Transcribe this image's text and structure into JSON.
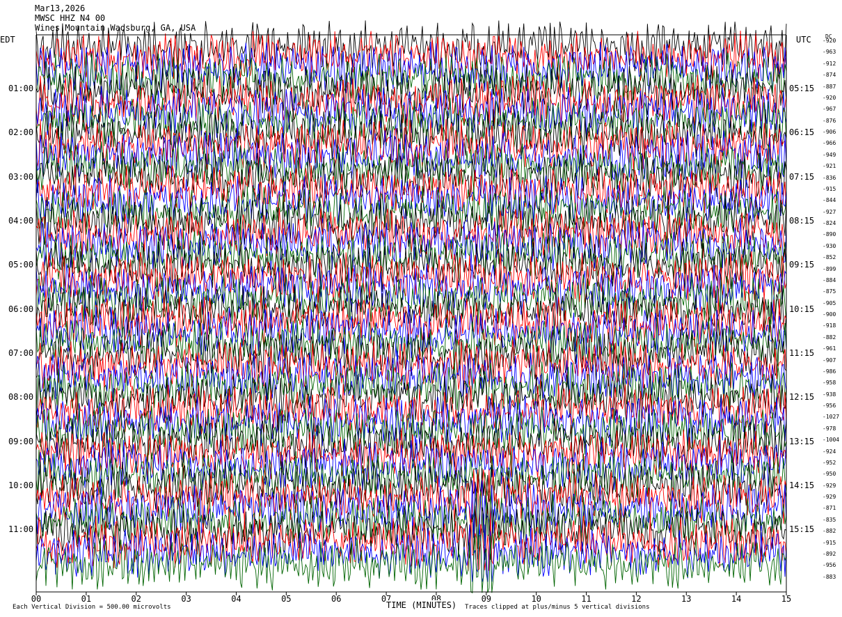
{
  "header": {
    "date": "Mar13,2026",
    "station": "MWSC HHZ N4 00",
    "location": "Wines Mountain Wadsburg, GA, USA"
  },
  "left_axis_label": "EDT",
  "right_axis_label": "UTC",
  "dc_label": "DC",
  "xaxis_title": "TIME (MINUTES)",
  "footer_left": "Each Vertical Division =  500.00 microvolts",
  "footer_right": "Traces clipped at plus/minus 5 vertical divisions",
  "chart_data": {
    "type": "line",
    "title": "",
    "xlabel": "TIME (MINUTES)",
    "ylabel": "",
    "xlim": [
      0,
      15
    ],
    "x_ticks": [
      "00",
      "01",
      "02",
      "03",
      "04",
      "05",
      "06",
      "07",
      "08",
      "09",
      "10",
      "11",
      "12",
      "13",
      "14",
      "15"
    ],
    "left_time_labels": [
      "01:00",
      "02:00",
      "03:00",
      "04:00",
      "05:00",
      "06:00",
      "07:00",
      "08:00",
      "09:00",
      "10:00",
      "11:00"
    ],
    "right_time_labels": [
      "05:15",
      "06:15",
      "07:15",
      "08:15",
      "09:15",
      "10:15",
      "11:15",
      "12:15",
      "13:15",
      "14:15",
      "15:15"
    ],
    "trace_color_cycle": [
      "#000000",
      "#ff0000",
      "#0000ff",
      "#006400"
    ],
    "traces_per_hour": 4,
    "trace_count": 48,
    "dc_offsets": [
      -920,
      -963,
      -912,
      -874,
      -887,
      -920,
      -967,
      -876,
      -906,
      -966,
      -949,
      -921,
      -836,
      -915,
      -844,
      -927,
      -824,
      -890,
      -930,
      -852,
      -899,
      -884,
      -875,
      -905,
      -900,
      -918,
      -882,
      -961,
      -907,
      -986,
      -958,
      -938,
      -956,
      -1027,
      -978,
      -1004,
      -924,
      -952,
      -950,
      -929,
      -929,
      -871,
      -835,
      -882,
      -915,
      -892,
      -956,
      -883
    ],
    "clip_divisions": 5,
    "microvolts_per_division": 500.0
  }
}
